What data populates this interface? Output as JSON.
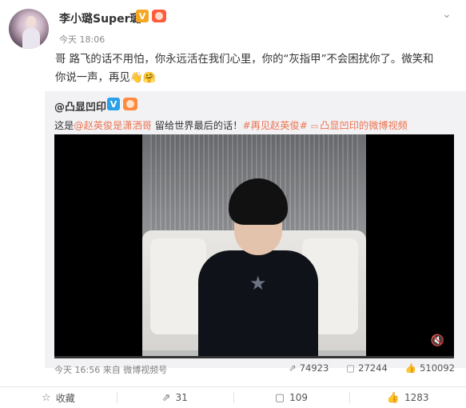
{
  "post": {
    "username": "李小璐Super璐",
    "time": "今天 18:06",
    "text_line1": "哥 路飞的话不用怕，你永远活在我们心里，你的“灰指甲”不会困扰你了。微笑和",
    "text_line2": "你说一声，再见",
    "emojis": [
      "👋",
      "🤗"
    ],
    "badge_v": "V"
  },
  "repost": {
    "username": "@凸显凹印",
    "badge_v": "V",
    "text_prefix": "这是",
    "mention": "@赵英俊是潇洒哥",
    "text_middle": " 留给世界最后的话！",
    "hashtag": "#再见赵英俊#",
    "video_link": "凸显凹印的微博视频",
    "footer": "今天 16:56 来自 微博视频号",
    "stats": {
      "reposts": "74923",
      "comments": "27244",
      "likes": "510092"
    }
  },
  "actions": {
    "favorite": "收藏",
    "repost": "31",
    "comment": "109",
    "like": "1283"
  },
  "icons": {
    "chevron": "chevron-down-icon",
    "share": "share-icon",
    "comment": "comment-icon",
    "like": "thumbs-up-icon",
    "favorite": "star-icon",
    "mute": "mute-icon"
  },
  "colors": {
    "link": "#eb7350",
    "badge_orange": "#f5a623",
    "badge_blue": "#2aa0e8",
    "repost_bg": "#f2f2f5"
  }
}
